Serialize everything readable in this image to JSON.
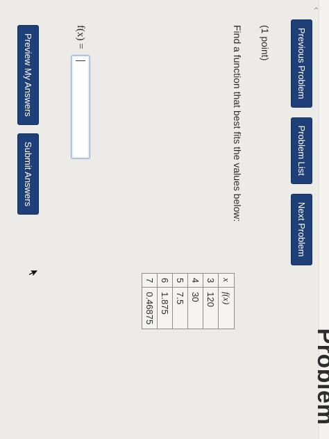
{
  "page": {
    "heading": "Problem"
  },
  "nav": {
    "previous_label": "Previous Problem",
    "list_label": "Problem List",
    "next_label": "Next Problem"
  },
  "problem": {
    "points": "(1 point)",
    "prompt": "Find a function that best fits the values below:",
    "table": {
      "headers": [
        "x",
        "f(x)"
      ],
      "rows": [
        [
          "3",
          "120"
        ],
        [
          "4",
          "30"
        ],
        [
          "5",
          "7.5"
        ],
        [
          "6",
          "1.875"
        ],
        [
          "7",
          "0.46875"
        ]
      ]
    },
    "answer": {
      "label": "f(x) =",
      "value": ""
    }
  },
  "actions": {
    "preview_label": "Preview My Answers",
    "submit_label": "Submit Answers"
  },
  "icons": [
    "chevron-left-icon",
    "mouse-pointer-icon"
  ],
  "colors": {
    "button": "#1f3f79",
    "page": "#ecebe7",
    "input_border": "#8fa9c9"
  }
}
